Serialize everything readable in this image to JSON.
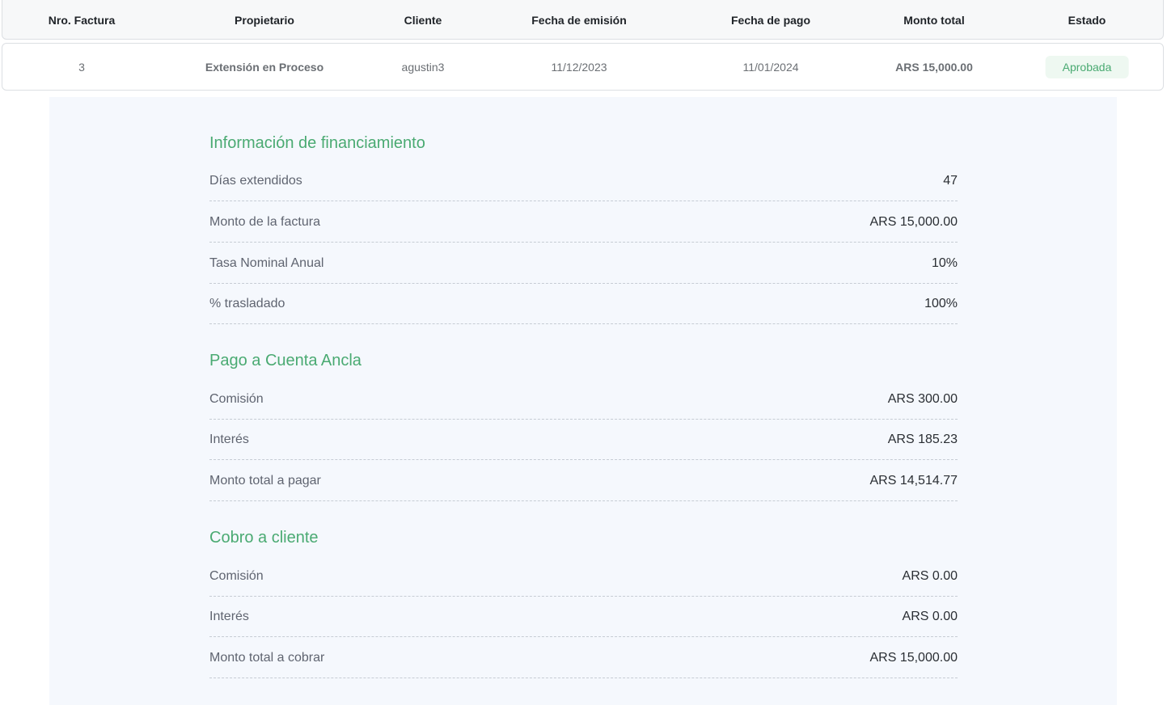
{
  "table": {
    "headers": {
      "invoice_number": "Nro. Factura",
      "owner": "Propietario",
      "client": "Cliente",
      "issue_date": "Fecha de emisión",
      "payment_date": "Fecha de pago",
      "total_amount": "Monto total",
      "status": "Estado"
    },
    "row": {
      "invoice_number": "3",
      "owner": "Extensión en Proceso",
      "client": "agustin3",
      "issue_date": "11/12/2023",
      "payment_date": "11/01/2024",
      "total_amount": "ARS 15,000.00",
      "status": "Aprobada"
    }
  },
  "financing": {
    "title": "Información de financiamiento",
    "rows": [
      {
        "label": "Días extendidos",
        "value": "47"
      },
      {
        "label": "Monto de la factura",
        "value": "ARS 15,000.00"
      },
      {
        "label": "Tasa Nominal Anual",
        "value": "10%"
      },
      {
        "label": "% trasladado",
        "value": "100%"
      }
    ]
  },
  "anchor_payment": {
    "title": "Pago a Cuenta Ancla",
    "rows": [
      {
        "label": "Comisión",
        "value": "ARS 300.00"
      },
      {
        "label": "Interés",
        "value": "ARS 185.23"
      },
      {
        "label": "Monto total a pagar",
        "value": "ARS 14,514.77"
      }
    ]
  },
  "client_charge": {
    "title": "Cobro a cliente",
    "rows": [
      {
        "label": "Comisión",
        "value": "ARS 0.00"
      },
      {
        "label": "Interés",
        "value": "ARS 0.00"
      },
      {
        "label": "Monto total a cobrar",
        "value": "ARS 15,000.00"
      }
    ]
  },
  "colors": {
    "accent_green": "#4aaa72",
    "badge_bg": "#eef8f1",
    "panel_bg": "#f5f8fd"
  }
}
